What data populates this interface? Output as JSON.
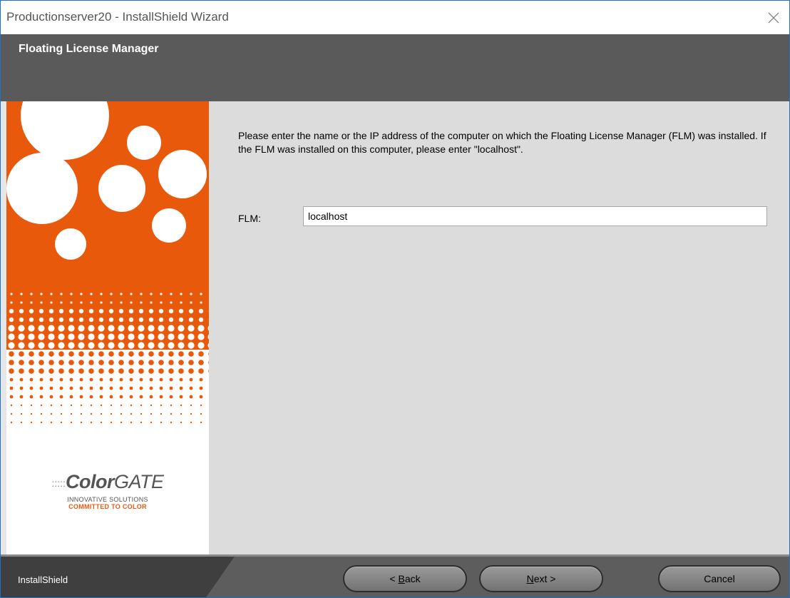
{
  "window": {
    "title": "Productionserver20 - InstallShield Wizard"
  },
  "header": {
    "title": "Floating License Manager"
  },
  "sidebar": {
    "brand_dots": ":::::",
    "brand_color": "Color",
    "brand_gate": "GATE",
    "tagline_line1": "INNOVATIVE SOLUTIONS",
    "tagline_line2": "COMMITTED TO COLOR"
  },
  "main": {
    "instructions": "Please enter the name or the IP address of the computer on which the Floating License Manager (FLM) was installed. If the FLM was installed on this computer, please enter \"localhost\".",
    "flm_label": "FLM:",
    "flm_value": "localhost"
  },
  "footer": {
    "brand": "InstallShield",
    "back_label": "< Back",
    "back_mnemonic": "B",
    "next_label": "Next >",
    "next_mnemonic": "N",
    "cancel_label": "Cancel"
  },
  "colors": {
    "accent_orange": "#e8590c",
    "header_gray": "#5a5a5a",
    "content_gray": "#dcdcdc"
  },
  "icons": {
    "close": "close-icon"
  }
}
